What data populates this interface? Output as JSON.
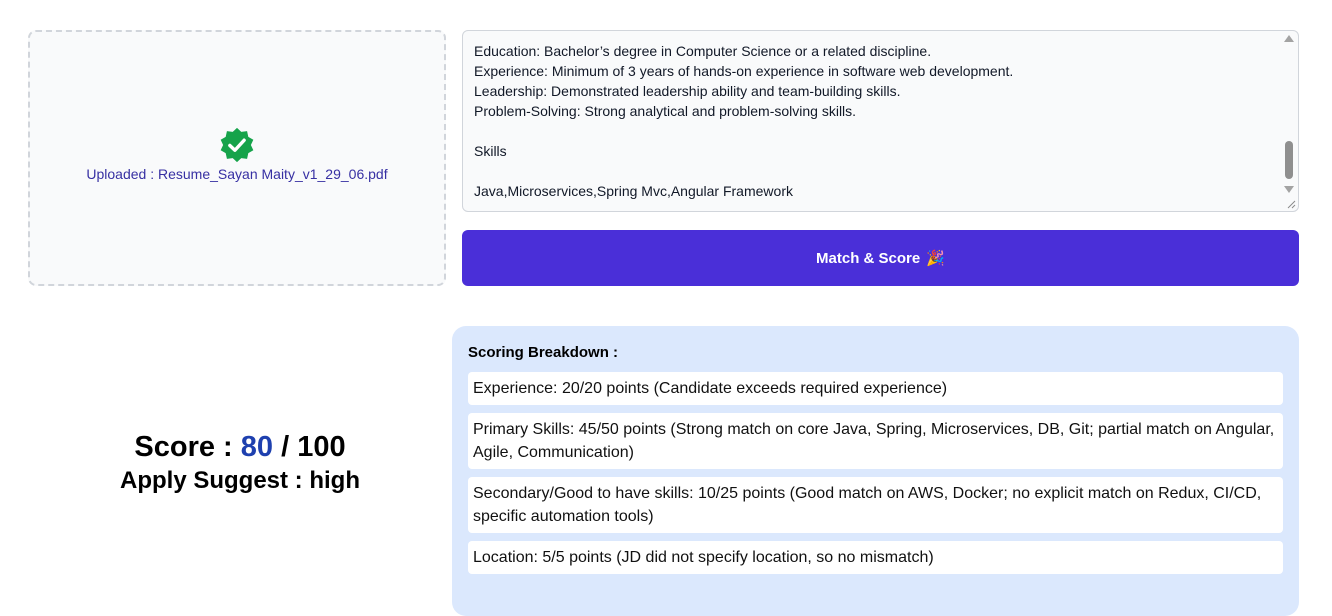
{
  "upload": {
    "icon": "verified-check-badge-icon",
    "icon_color": "#16a34a",
    "text": "Uploaded : Resume_Sayan Maity_v1_29_06.pdf"
  },
  "job_description": {
    "text": "Education: Bachelor’s degree in Computer Science or a related discipline.\nExperience: Minimum of 3 years of hands-on experience in software web development.\nLeadership: Demonstrated leadership ability and team-building skills.\nProblem-Solving: Strong analytical and problem-solving skills.\n\nSkills\n\nJava,Microservices,Spring Mvc,Angular Framework"
  },
  "match_button": {
    "label": "Match & Score",
    "emoji": "🎉",
    "color": "#4a2fd8"
  },
  "score": {
    "prefix": "Score : ",
    "value": "80",
    "suffix": " / 100",
    "value_color": "#1e40af",
    "apply_label": "Apply Suggest : high"
  },
  "breakdown": {
    "title": "Scoring Breakdown :",
    "background": "#dbe8fd",
    "items": [
      "Experience: 20/20 points (Candidate exceeds required experience)",
      "Primary Skills: 45/50 points (Strong match on core Java, Spring, Microservices, DB, Git; partial match on Angular, Agile, Communication)",
      "Secondary/Good to have skills: 10/25 points (Good match on AWS, Docker; no explicit match on Redux, CI/CD, specific automation tools)",
      "Location: 5/5 points (JD did not specify location, so no mismatch)"
    ]
  }
}
